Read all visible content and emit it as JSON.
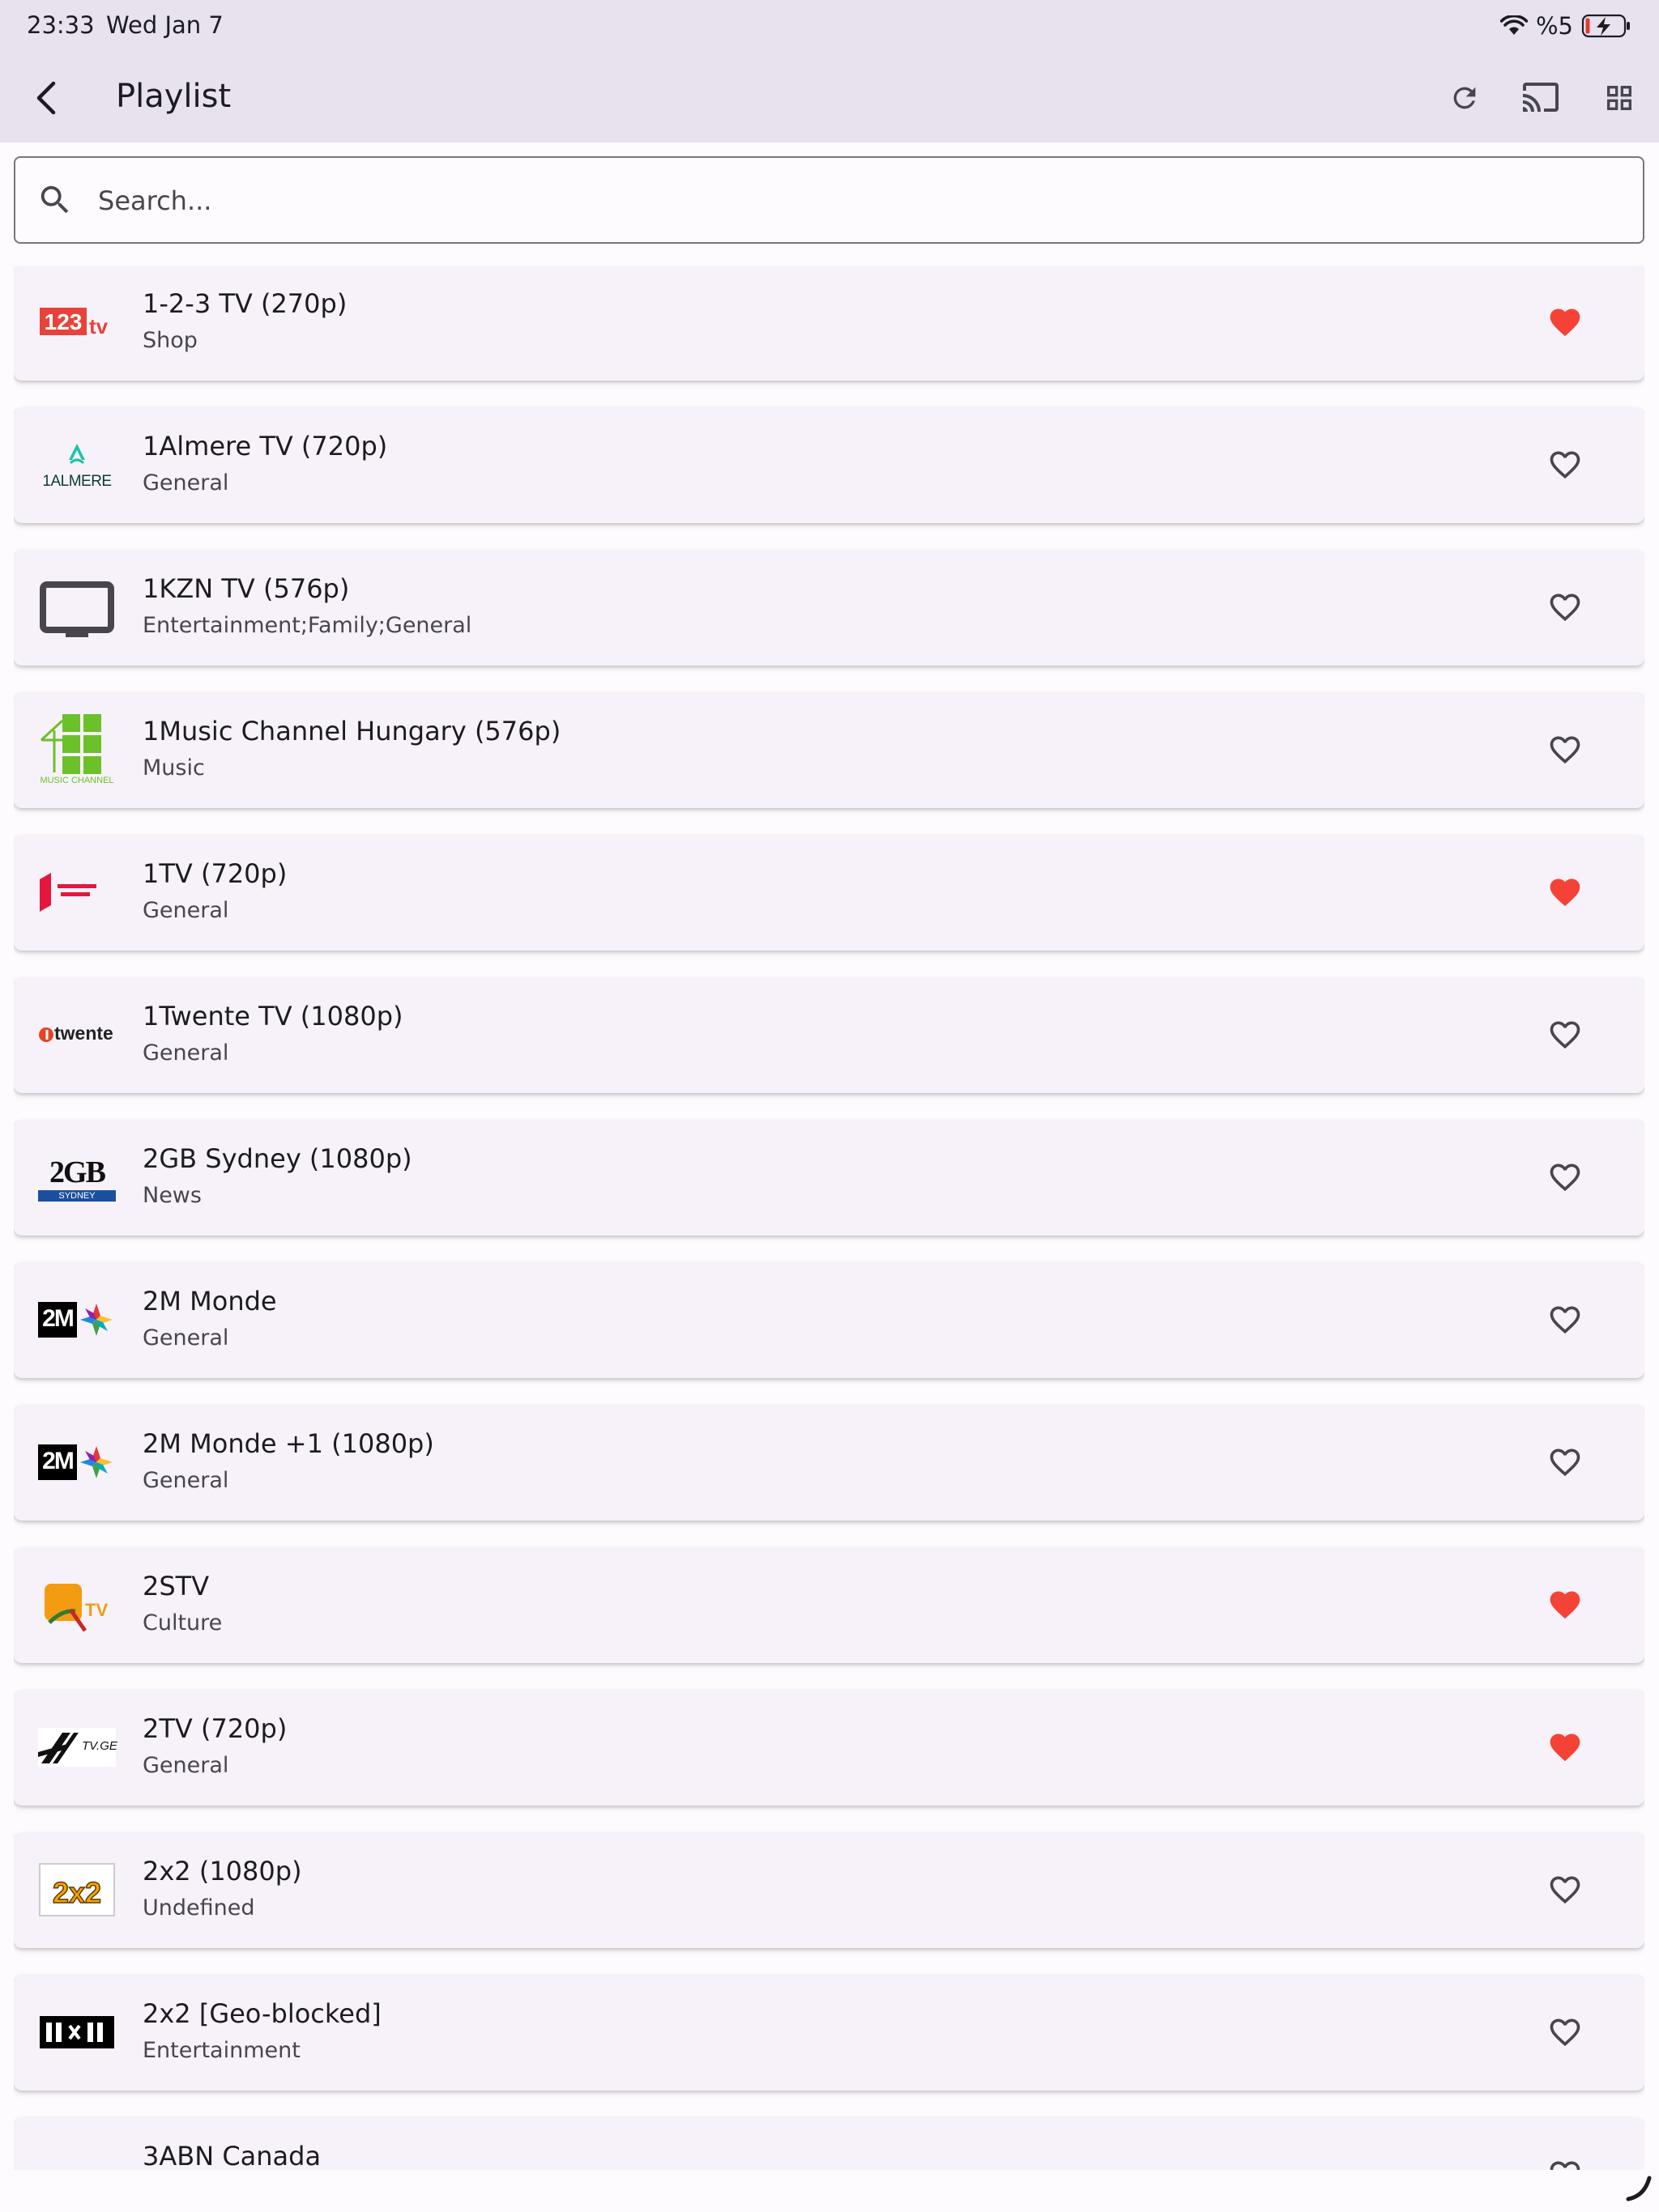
{
  "status_bar": {
    "time": "23:33",
    "date": "Wed Jan 7",
    "battery": "%5"
  },
  "app_bar": {
    "title": "Playlist"
  },
  "search": {
    "placeholder": "Search..."
  },
  "colors": {
    "favorite": "#f44336",
    "app_bar_bg": "#e8e2ef",
    "card_bg": "#f7f2fa"
  },
  "channels": [
    {
      "name": "1-2-3 TV (270p)",
      "category": "Shop",
      "favorite": true,
      "logo": "123tv-logo"
    },
    {
      "name": "1Almere TV (720p)",
      "category": "General",
      "favorite": false,
      "logo": "1almere-logo",
      "logo_text": "1ALMERE"
    },
    {
      "name": "1KZN TV (576p)",
      "category": "Entertainment;Family;General",
      "favorite": false,
      "logo": "tv-placeholder-icon"
    },
    {
      "name": "1Music Channel Hungary (576p)",
      "category": "Music",
      "favorite": false,
      "logo": "1music-logo",
      "logo_text": "MUSIC CHANNEL"
    },
    {
      "name": "1TV (720p)",
      "category": "General",
      "favorite": true,
      "logo": "1tv-georgia-logo"
    },
    {
      "name": "1Twente TV (1080p)",
      "category": "General",
      "favorite": false,
      "logo": "1twente-logo",
      "logo_text": "twente"
    },
    {
      "name": "2GB Sydney (1080p)",
      "category": "News",
      "favorite": false,
      "logo": "2gb-logo",
      "logo_text": "2GB",
      "logo_subtext": "SYDNEY"
    },
    {
      "name": "2M Monde",
      "category": "General",
      "favorite": false,
      "logo": "2m-logo",
      "logo_text": "2M"
    },
    {
      "name": "2M Monde +1 (1080p)",
      "category": "General",
      "favorite": false,
      "logo": "2m-logo",
      "logo_text": "2M"
    },
    {
      "name": "2STV",
      "category": "Culture",
      "favorite": true,
      "logo": "2stv-logo"
    },
    {
      "name": "2TV (720p)",
      "category": "General",
      "favorite": true,
      "logo": "2tv-logo",
      "logo_text": "TV.GE"
    },
    {
      "name": "2x2 (1080p)",
      "category": "Undefined",
      "favorite": false,
      "logo": "2x2-logo"
    },
    {
      "name": "2x2 [Geo-blocked]",
      "category": "Entertainment",
      "favorite": false,
      "logo": "2x2-geo-logo"
    },
    {
      "name": "3ABN Canada",
      "category": "",
      "favorite": false,
      "logo": "3abn-logo"
    }
  ]
}
